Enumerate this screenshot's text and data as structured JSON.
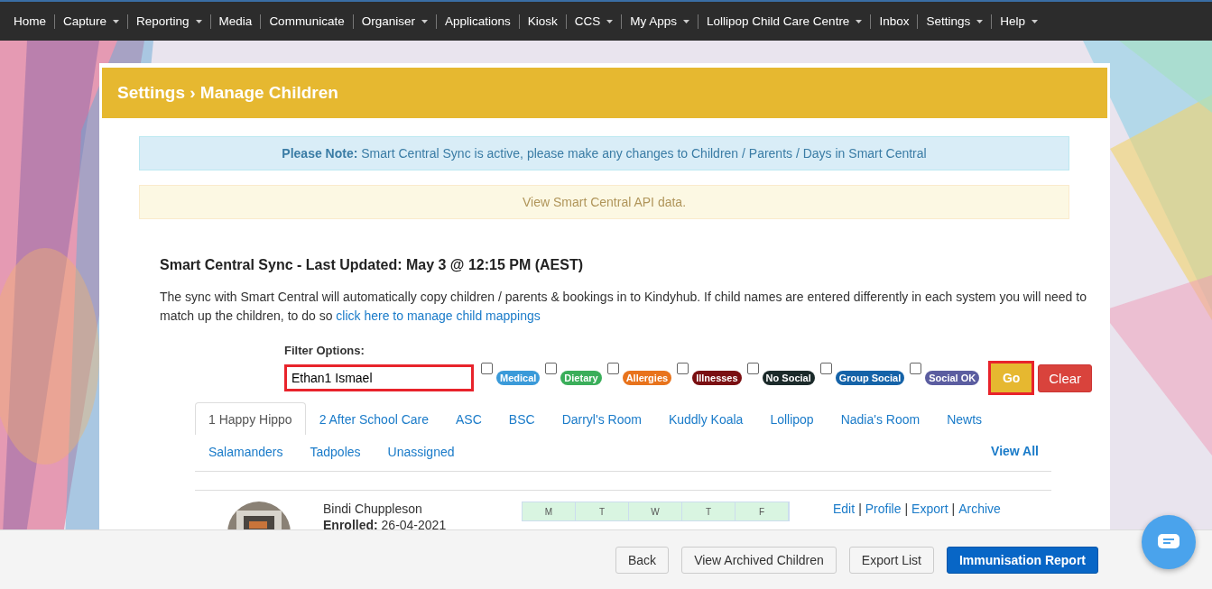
{
  "nav": [
    {
      "label": "Home",
      "caret": false
    },
    {
      "label": "Capture",
      "caret": true
    },
    {
      "label": "Reporting",
      "caret": true
    },
    {
      "label": "Media",
      "caret": false
    },
    {
      "label": "Communicate",
      "caret": false
    },
    {
      "label": "Organiser",
      "caret": true
    },
    {
      "label": "Applications",
      "caret": false
    },
    {
      "label": "Kiosk",
      "caret": false
    },
    {
      "label": "CCS",
      "caret": true
    },
    {
      "label": "My Apps",
      "caret": true
    },
    {
      "label": "Lollipop Child Care Centre",
      "caret": true
    },
    {
      "label": "Inbox",
      "caret": false
    },
    {
      "label": "Settings",
      "caret": true
    },
    {
      "label": "Help",
      "caret": true
    }
  ],
  "header": {
    "title": "Settings › Manage Children"
  },
  "notice": "**Please Note:** Smart Central Sync is active, please make any changes to Children / Parents / Days in Smart Central",
  "api_link": "View Smart Central API data.",
  "sync": {
    "title": "Smart Central Sync - Last Updated: May 3 @ 12:15 PM (AEST)",
    "text": "The sync with Smart Central will automatically copy children / parents & bookings in to Kindyhub. If child names are entered differently in each system you will need to match up the children, to do so",
    "link": "click here to manage child mappings"
  },
  "filter": {
    "label": "Filter Options:",
    "value": "Ethan1 Ismael",
    "highlighted": true,
    "tags": [
      {
        "label": "Medical",
        "checked": false,
        "color": "#3a9ad9"
      },
      {
        "label": "Dietary",
        "checked": false,
        "color": "#3aae5a"
      },
      {
        "label": "Allergies",
        "checked": false,
        "color": "#e8731c"
      },
      {
        "label": "Illnesses",
        "checked": false,
        "color": "#7a0f12"
      },
      {
        "label": "No Social",
        "checked": false,
        "color": "#1b2a2a"
      },
      {
        "label": "Group Social",
        "checked": false,
        "color": "#1563a8"
      },
      {
        "label": "Social OK",
        "checked": false,
        "color": "#5b5da0"
      }
    ],
    "go": {
      "label": "Go",
      "highlighted": true
    },
    "clear": "Clear"
  },
  "rooms": [
    {
      "label": "1 Happy Hippo",
      "selected": true
    },
    {
      "label": "2 After School Care",
      "selected": false
    },
    {
      "label": "ASC",
      "selected": false
    },
    {
      "label": "BSC",
      "selected": false
    },
    {
      "label": "Darryl's Room",
      "selected": false
    },
    {
      "label": "Kuddly Koala",
      "selected": false
    },
    {
      "label": "Lollipop",
      "selected": false
    },
    {
      "label": "Nadia's Room",
      "selected": false
    },
    {
      "label": "Newts",
      "selected": false
    },
    {
      "label": "Salamanders",
      "selected": false
    },
    {
      "label": "Tadpoles",
      "selected": false
    },
    {
      "label": "Unassigned",
      "selected": false
    }
  ],
  "view_all": "View All",
  "children": [
    {
      "name": "Bindi Chuppleson",
      "enrolled_label": "Enrolled:",
      "enrolled": "26-04-2021",
      "days": [
        "M",
        "T",
        "W",
        "T",
        "F"
      ],
      "actions": [
        "Edit",
        "Profile",
        "Export",
        "Archive"
      ],
      "action_separator": "|"
    }
  ],
  "footer": {
    "buttons": [
      {
        "label": "Back",
        "kind": "default"
      },
      {
        "label": "View Archived Children",
        "kind": "default"
      },
      {
        "label": "Export List",
        "kind": "default"
      },
      {
        "label": "Immunisation Report",
        "kind": "primary"
      }
    ]
  }
}
